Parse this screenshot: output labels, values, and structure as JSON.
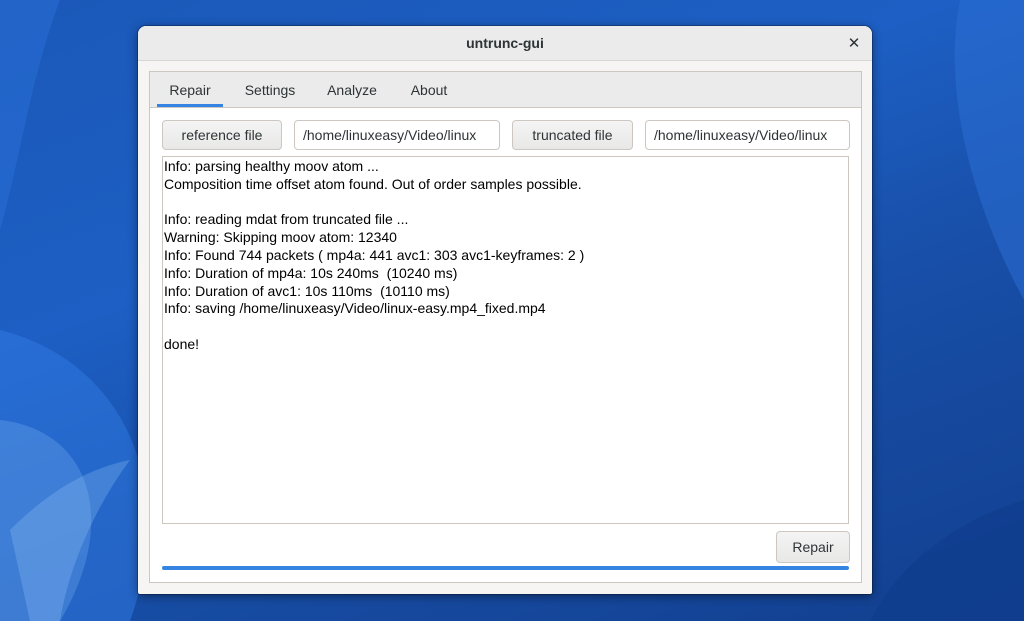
{
  "window": {
    "title": "untrunc-gui",
    "close_icon": "✕"
  },
  "tabs": [
    {
      "label": "Repair",
      "active": true
    },
    {
      "label": "Settings",
      "active": false
    },
    {
      "label": "Analyze",
      "active": false
    },
    {
      "label": "About",
      "active": false
    }
  ],
  "files": {
    "reference_button_label": "reference file",
    "reference_path": "/home/linuxeasy/Video/linux",
    "truncated_button_label": "truncated file",
    "truncated_path": "/home/linuxeasy/Video/linux"
  },
  "log": {
    "lines": [
      "Info: parsing healthy moov atom ...",
      "Composition time offset atom found. Out of order samples possible.",
      "",
      "Info: reading mdat from truncated file ...",
      "Warning: Skipping moov atom: 12340",
      "Info: Found 744 packets ( mp4a: 441 avc1: 303 avc1-keyframes: 2 )",
      "Info: Duration of mp4a: 10s 240ms  (10240 ms)",
      "Info: Duration of avc1: 10s 110ms  (10110 ms)",
      "Info: saving /home/linuxeasy/Video/linux-easy.mp4_fixed.mp4",
      "",
      "done!"
    ]
  },
  "actions": {
    "repair_label": "Repair"
  },
  "progress": {
    "fraction": 1.0
  },
  "colors": {
    "accent": "#3584e4",
    "desktop": "#1d5fc4"
  }
}
